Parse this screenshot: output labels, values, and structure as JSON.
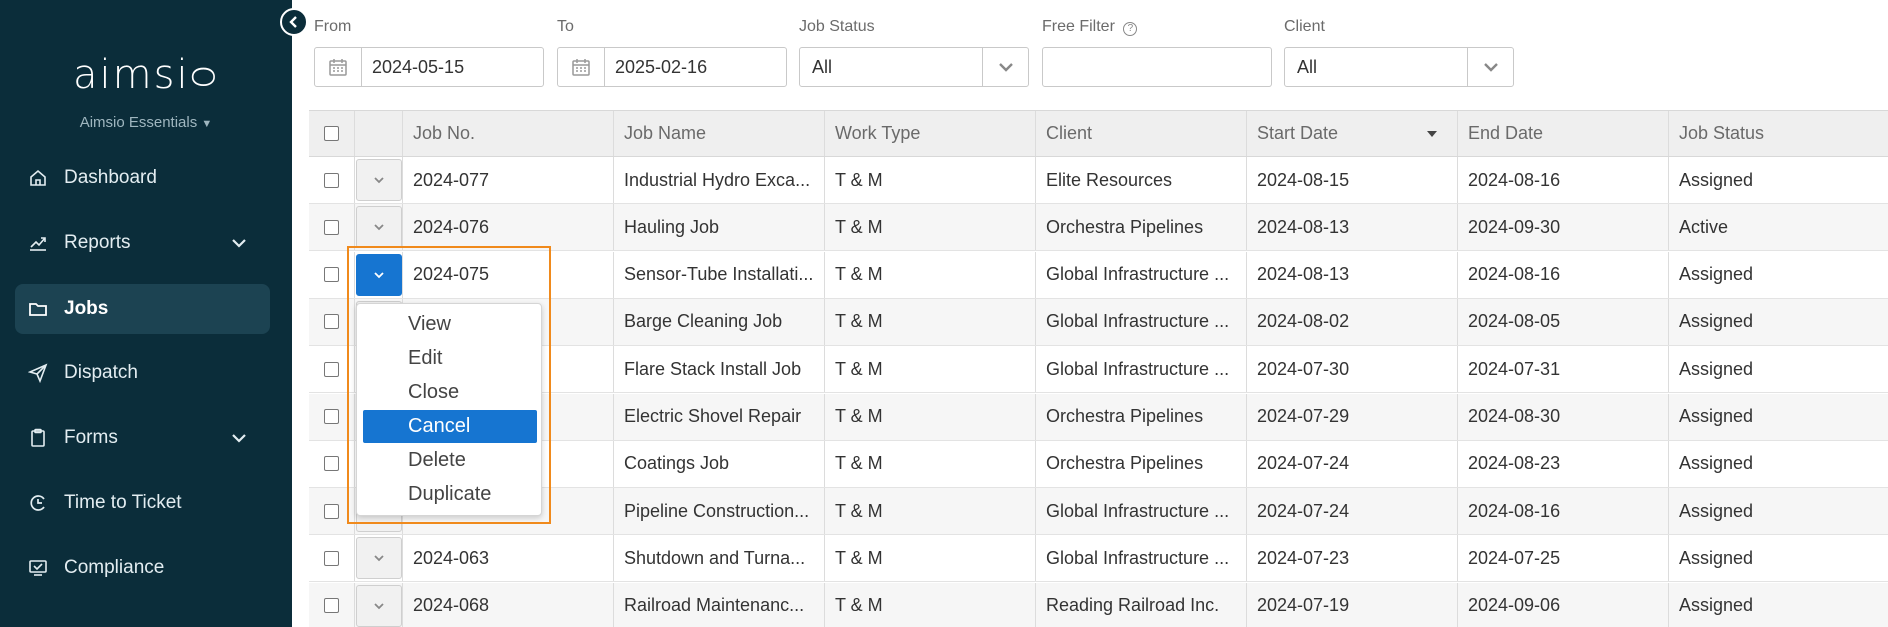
{
  "sidebar": {
    "logo": "aimsiᴑ",
    "subtitle": "Aimsio Essentials",
    "items": [
      {
        "label": "Dashboard",
        "icon": "home-icon"
      },
      {
        "label": "Reports",
        "icon": "chart-icon"
      },
      {
        "label": "Jobs",
        "icon": "folder-icon"
      },
      {
        "label": "Dispatch",
        "icon": "send-icon"
      },
      {
        "label": "Forms",
        "icon": "clipboard-icon"
      },
      {
        "label": "Time to Ticket",
        "icon": "time-ticket-icon"
      },
      {
        "label": "Compliance",
        "icon": "compliance-icon"
      }
    ]
  },
  "filters": {
    "from_label": "From",
    "from_value": "2024-05-15",
    "to_label": "To",
    "to_value": "2025-02-16",
    "status_label": "Job Status",
    "status_value": "All",
    "free_label": "Free Filter",
    "free_value": "",
    "client_label": "Client",
    "client_value": "All"
  },
  "table": {
    "headers": [
      "Job No.",
      "Job Name",
      "Work Type",
      "Client",
      "Start Date",
      "End Date",
      "Job Status"
    ],
    "rows": [
      {
        "no": "2024-077",
        "name": "Industrial Hydro Exca...",
        "type": "T & M",
        "client": "Elite Resources",
        "start": "2024-08-15",
        "end": "2024-08-16",
        "status": "Assigned"
      },
      {
        "no": "2024-076",
        "name": "Hauling Job",
        "type": "T & M",
        "client": "Orchestra Pipelines",
        "start": "2024-08-13",
        "end": "2024-09-30",
        "status": "Active"
      },
      {
        "no": "2024-075",
        "name": "Sensor-Tube Installati...",
        "type": "T & M",
        "client": "Global Infrastructure ...",
        "start": "2024-08-13",
        "end": "2024-08-16",
        "status": "Assigned"
      },
      {
        "no": "",
        "name": "Barge Cleaning Job",
        "type": "T & M",
        "client": "Global Infrastructure ...",
        "start": "2024-08-02",
        "end": "2024-08-05",
        "status": "Assigned"
      },
      {
        "no": "",
        "name": "Flare Stack Install Job",
        "type": "T & M",
        "client": "Global Infrastructure ...",
        "start": "2024-07-30",
        "end": "2024-07-31",
        "status": "Assigned"
      },
      {
        "no": "",
        "name": "Electric Shovel Repair",
        "type": "T & M",
        "client": "Orchestra Pipelines",
        "start": "2024-07-29",
        "end": "2024-08-30",
        "status": "Assigned"
      },
      {
        "no": "",
        "name": "Coatings Job",
        "type": "T & M",
        "client": "Orchestra Pipelines",
        "start": "2024-07-24",
        "end": "2024-08-23",
        "status": "Assigned"
      },
      {
        "no": "",
        "name": "Pipeline Construction...",
        "type": "T & M",
        "client": "Global Infrastructure ...",
        "start": "2024-07-24",
        "end": "2024-08-16",
        "status": "Assigned"
      },
      {
        "no": "2024-063",
        "name": "Shutdown and Turna...",
        "type": "T & M",
        "client": "Global Infrastructure ...",
        "start": "2024-07-23",
        "end": "2024-07-25",
        "status": "Assigned"
      },
      {
        "no": "2024-068",
        "name": "Railroad Maintenanc...",
        "type": "T & M",
        "client": "Reading Railroad Inc.",
        "start": "2024-07-19",
        "end": "2024-09-06",
        "status": "Assigned"
      }
    ]
  },
  "menu": {
    "items": [
      "View",
      "Edit",
      "Close",
      "Cancel",
      "Delete",
      "Duplicate"
    ],
    "selected": "Cancel"
  },
  "colors": {
    "sidebar_bg": "#0b2d3a",
    "accent": "#1675d1",
    "highlight": "#f08a1c"
  }
}
